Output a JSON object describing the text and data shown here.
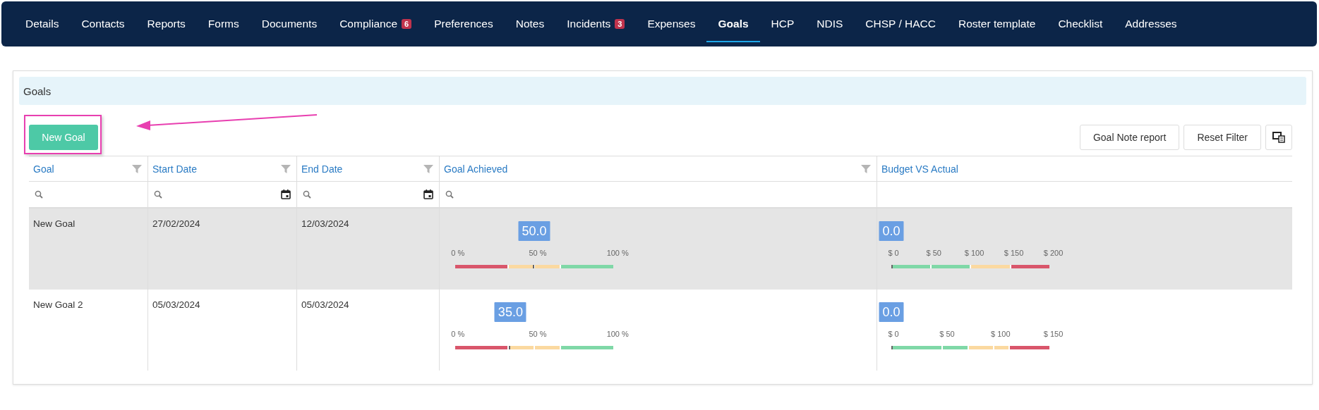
{
  "tabs": [
    {
      "label": "Details",
      "selected": false
    },
    {
      "label": "Contacts",
      "selected": false
    },
    {
      "label": "Reports",
      "selected": false
    },
    {
      "label": "Forms",
      "selected": false
    },
    {
      "label": "Documents",
      "selected": false
    },
    {
      "label": "Compliance",
      "badge": "6",
      "selected": false
    },
    {
      "label": "Preferences",
      "selected": false
    },
    {
      "label": "Notes",
      "selected": false
    },
    {
      "label": "Incidents",
      "badge": "3",
      "selected": false
    },
    {
      "label": "Expenses",
      "selected": false
    },
    {
      "label": "Goals",
      "selected": true
    },
    {
      "label": "HCP",
      "selected": false
    },
    {
      "label": "NDIS",
      "selected": false
    },
    {
      "label": "CHSP / HACC",
      "selected": false
    },
    {
      "label": "Roster template",
      "selected": false
    },
    {
      "label": "Checklist",
      "selected": false
    },
    {
      "label": "Addresses",
      "selected": false
    }
  ],
  "panel": {
    "title": "Goals",
    "new_button": "New Goal",
    "toolbar_buttons": [
      "Goal Note report",
      "Reset Filter"
    ]
  },
  "table": {
    "columns": [
      {
        "label": "Goal",
        "filter": true,
        "search": true,
        "calendar": false
      },
      {
        "label": "Start Date",
        "filter": true,
        "search": true,
        "calendar": true
      },
      {
        "label": "End Date",
        "filter": true,
        "search": true,
        "calendar": true
      },
      {
        "label": "Goal Achieved",
        "filter": true,
        "search": true,
        "calendar": false
      },
      {
        "label": "Budget VS Actual",
        "filter": false,
        "search": false,
        "calendar": false
      }
    ],
    "rows": [
      {
        "goal": "New Goal",
        "start": "27/02/2024",
        "end": "12/03/2024",
        "selected": true,
        "achieved": {
          "value": "50.0",
          "level": 0.5,
          "labels": [
            "0 %",
            "50 %",
            "100 %"
          ]
        },
        "budget": {
          "value": "0.0",
          "level": 0,
          "labels": [
            "$ 0",
            "$ 50",
            "$ 100",
            "$ 150",
            "$ 200"
          ]
        }
      },
      {
        "goal": "New Goal 2",
        "start": "05/03/2024",
        "end": "05/03/2024",
        "selected": false,
        "achieved": {
          "value": "35.0",
          "level": 0.35,
          "labels": [
            "0 %",
            "50 %",
            "100 %"
          ]
        },
        "budget": {
          "value": "0.0",
          "level": 0,
          "labels": [
            "$ 0",
            "$ 50",
            "$ 100",
            "$ 150"
          ]
        }
      }
    ]
  }
}
